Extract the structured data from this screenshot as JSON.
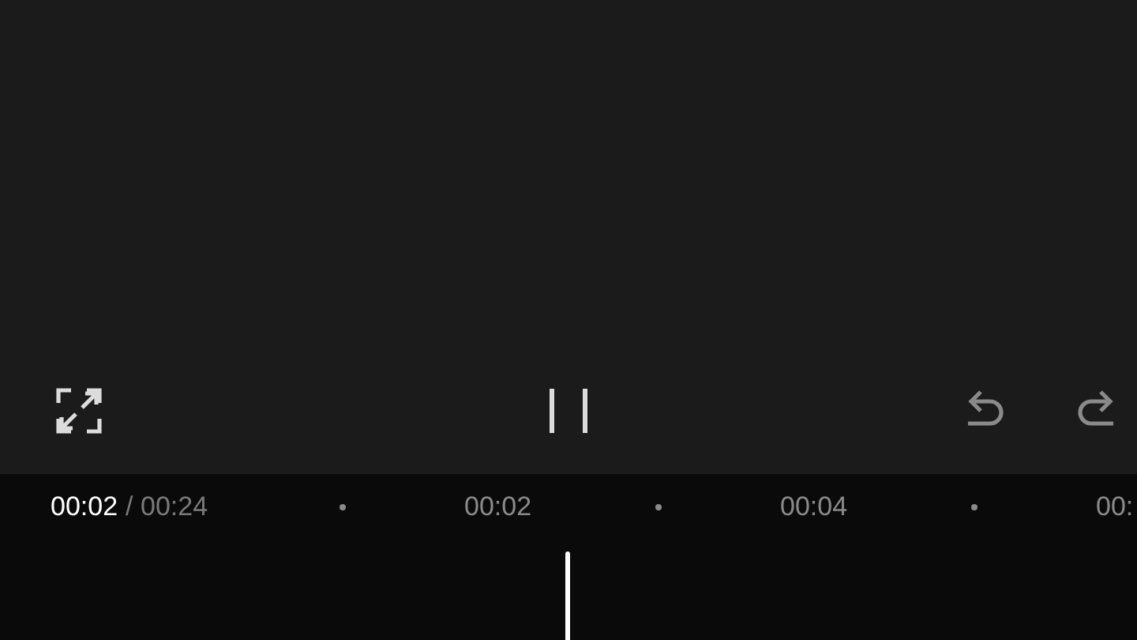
{
  "controls": [
    {
      "kind": "fullscreen",
      "disabled": false
    },
    {
      "kind": "pause",
      "disabled": false
    },
    {
      "kind": "undo",
      "disabled": true
    },
    {
      "kind": "redo",
      "disabled": true
    }
  ],
  "timeline": {
    "current_time": "00:02",
    "total_time": "/ 00:24",
    "ruler": [
      {
        "kind": "dot"
      },
      {
        "kind": "label",
        "text": "00:02"
      },
      {
        "kind": "dot"
      },
      {
        "kind": "label",
        "text": "00:04"
      },
      {
        "kind": "dot"
      },
      {
        "kind": "label",
        "text": "00:"
      }
    ]
  }
}
